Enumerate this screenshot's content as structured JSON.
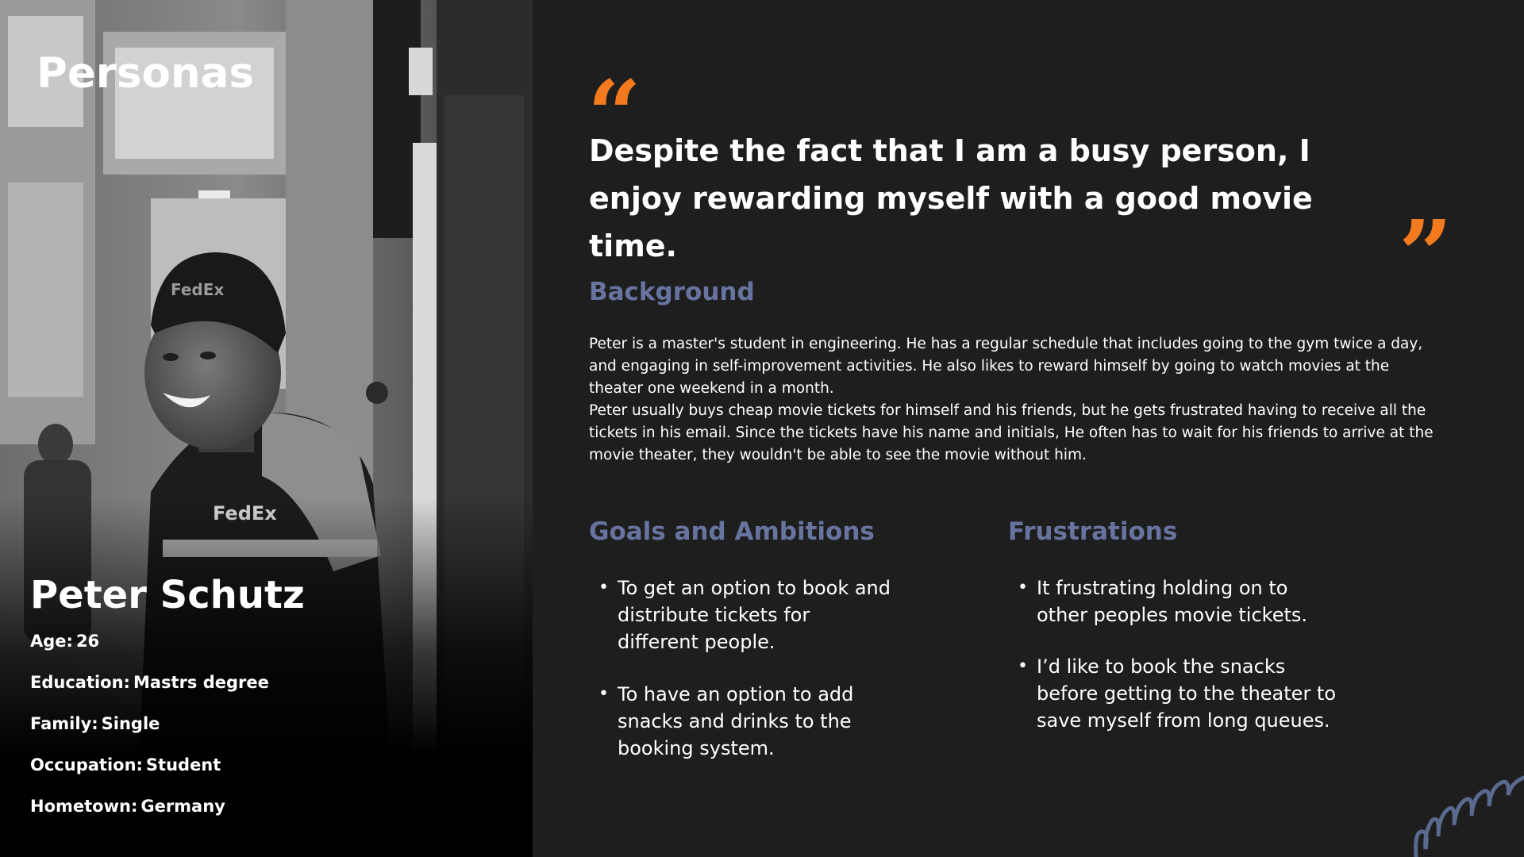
{
  "page_title": "Personas",
  "persona": {
    "name": "Peter Schutz",
    "facts": [
      {
        "label": "Age:",
        "value": "26"
      },
      {
        "label": "Education:",
        "value": "Mastrs degree"
      },
      {
        "label": "Family:",
        "value": "Single"
      },
      {
        "label": "Occupation:",
        "value": "Student"
      },
      {
        "label": "Hometown:",
        "value": "Germany"
      }
    ]
  },
  "quote": {
    "text": "Despite the fact that I am a busy person, I enjoy rewarding myself with a good movie time.",
    "open_mark": "“",
    "close_mark": "”"
  },
  "background": {
    "heading": "Background",
    "paragraphs": [
      "Peter is a master's student in engineering. He has a regular schedule that includes going to the gym twice a day, and engaging in self-improvement activities. He also likes to reward himself by going to watch movies at the theater one weekend in a month.",
      "Peter usually buys cheap movie tickets for himself and his friends, but he gets frustrated having to receive all the tickets in his email. Since the tickets have his name and initials, He often has to wait for his friends to arrive at the movie theater, they wouldn't be able to see the movie without him."
    ]
  },
  "goals": {
    "heading": "Goals and Ambitions",
    "items": [
      "To get an option to book and distribute tickets for different people.",
      "To have an option to add snacks and drinks to the booking system."
    ]
  },
  "frustrations": {
    "heading": "Frustrations",
    "items": [
      "It frustrating holding on to other peoples movie tickets.",
      "I’d like to book the snacks before getting to the theater to save myself from long queues."
    ]
  },
  "colors": {
    "background": "#1e1e1f",
    "accent_orange": "#f47a20",
    "heading_blue": "#6874a0",
    "text": "#ffffff"
  },
  "icons": [
    "quote-open-icon",
    "quote-close-icon",
    "squiggle-decoration"
  ]
}
